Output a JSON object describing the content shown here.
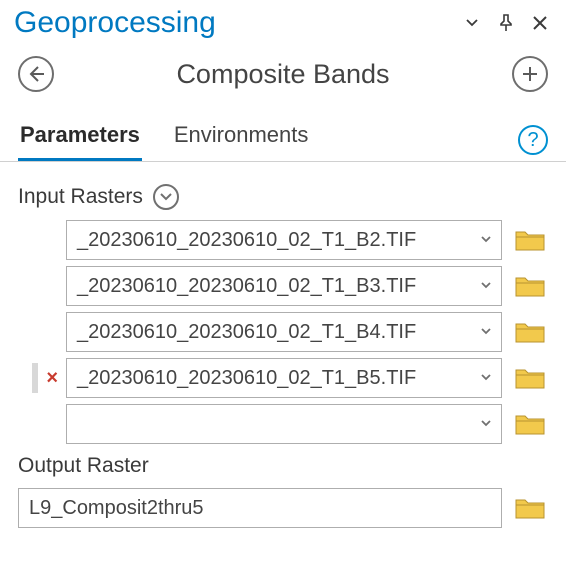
{
  "pane": {
    "title": "Geoprocessing"
  },
  "tool": {
    "title": "Composite Bands"
  },
  "tabs": {
    "parameters": "Parameters",
    "environments": "Environments"
  },
  "input_label": "Input Rasters",
  "input_rasters": [
    "_20230610_20230610_02_T1_B2.TIF",
    "_20230610_20230610_02_T1_B3.TIF",
    "_20230610_20230610_02_T1_B4.TIF",
    "_20230610_20230610_02_T1_B5.TIF",
    ""
  ],
  "hover_row_index": 3,
  "output_label": "Output Raster",
  "output_value": "L9_Composit2thru5"
}
